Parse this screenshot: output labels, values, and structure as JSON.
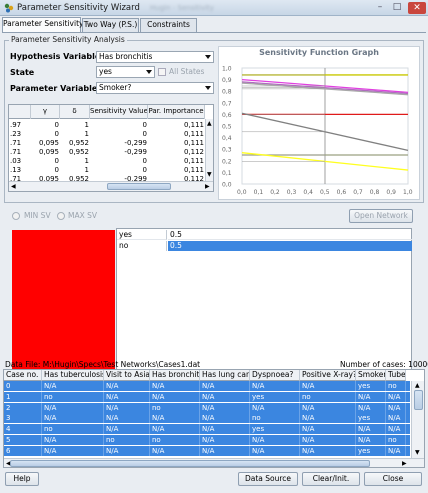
{
  "window": {
    "title": "Parameter Sensitivity Wizard",
    "blurred_text": "Hugin - Sensitivity"
  },
  "tabs": [
    "Parameter Sensitivity",
    "Two Way (P.S.)",
    "Constraints"
  ],
  "analysis": {
    "group_title": "Parameter Sensitivity Analysis",
    "hypothesis_label": "Hypothesis Variable",
    "hypothesis_value": "Has bronchitis",
    "state_label": "State",
    "state_value": "yes",
    "all_states_label": "All States",
    "parameter_label": "Parameter Variable",
    "parameter_value": "Smoker?"
  },
  "sens_table": {
    "headers": [
      "",
      "γ",
      "δ",
      "Sensitivity Value",
      "Par. Importance"
    ],
    "rows": [
      [
        ".97",
        "0",
        "1",
        "0",
        "0,111"
      ],
      [
        ".23",
        "0",
        "1",
        "0",
        "0,111"
      ],
      [
        ".71",
        "0,095",
        "0,952",
        "-0,299",
        "0,111"
      ],
      [
        ".71",
        "0,095",
        "0,952",
        "-0,299",
        "0,112"
      ],
      [
        ".03",
        "0",
        "1",
        "0",
        "0,111"
      ],
      [
        ".13",
        "0",
        "1",
        "0",
        "0,111"
      ],
      [
        ".71",
        "0,095",
        "0,952",
        "-0,299",
        "0,112"
      ]
    ]
  },
  "chart_data": {
    "type": "line",
    "title": "Sensitivity Function Graph",
    "xlim": [
      0,
      1
    ],
    "ylim": [
      0,
      1
    ],
    "x_ticks": [
      "0,0",
      "0,1",
      "0,2",
      "0,3",
      "0,4",
      "0,5",
      "0,6",
      "0,7",
      "0,8",
      "0,9",
      "1,0"
    ],
    "y_ticks": [
      "0,0",
      "0,1",
      "0,2",
      "0,3",
      "0,4",
      "0,5",
      "0,6",
      "0,7",
      "0,8",
      "0,9",
      "1,0"
    ],
    "marker_x": 0.5,
    "series": [
      {
        "color": "#c8c800",
        "x": [
          0,
          1
        ],
        "y": [
          0.94,
          0.94
        ]
      },
      {
        "color": "#e040e0",
        "x": [
          0,
          1
        ],
        "y": [
          0.9,
          0.79
        ]
      },
      {
        "color": "#b06ac0",
        "x": [
          0,
          1
        ],
        "y": [
          0.88,
          0.78
        ]
      },
      {
        "color": "#a8a8a8",
        "x": [
          0,
          1
        ],
        "y": [
          0.87,
          0.77
        ]
      },
      {
        "color": "#e01a1a",
        "x": [
          0,
          1
        ],
        "y": [
          0.6,
          0.6
        ]
      },
      {
        "color": "#808080",
        "x": [
          0,
          1
        ],
        "y": [
          0.61,
          0.29
        ]
      },
      {
        "color": "#9aa080",
        "x": [
          0,
          1
        ],
        "y": [
          0.25,
          0.25
        ]
      },
      {
        "color": "#ffff20",
        "x": [
          0,
          1
        ],
        "y": [
          0.27,
          0.12
        ]
      }
    ]
  },
  "controls": {
    "min_sv": "MIN SV",
    "max_sv": "MAX SV",
    "open_network": "Open Network"
  },
  "state_values": [
    {
      "state": "yes",
      "value": "0.5"
    },
    {
      "state": "no",
      "value": "0.5"
    }
  ],
  "data_file": {
    "label": "Data File: M:\\Hugin\\Specs\\Test Networks\\Cases1.dat",
    "count_label": "Number of cases: 10000"
  },
  "cases": {
    "headers": [
      "Case no.",
      "Has tuberculosis",
      "Visit to Asia?",
      "Has bronchitis",
      "Has lung cancer",
      "Dyspnoea?",
      "Positive X-ray?",
      "Smoker?",
      "Tube"
    ],
    "rows": [
      [
        "0",
        "N/A",
        "N/A",
        "N/A",
        "N/A",
        "N/A",
        "N/A",
        "yes",
        "no"
      ],
      [
        "1",
        "no",
        "N/A",
        "N/A",
        "N/A",
        "yes",
        "no",
        "N/A",
        "N/A"
      ],
      [
        "2",
        "N/A",
        "N/A",
        "no",
        "N/A",
        "N/A",
        "N/A",
        "N/A",
        "N/A"
      ],
      [
        "3",
        "N/A",
        "N/A",
        "N/A",
        "N/A",
        "no",
        "N/A",
        "yes",
        "N/A"
      ],
      [
        "4",
        "no",
        "N/A",
        "N/A",
        "N/A",
        "yes",
        "N/A",
        "N/A",
        "N/A"
      ],
      [
        "5",
        "N/A",
        "no",
        "no",
        "N/A",
        "N/A",
        "N/A",
        "N/A",
        "no"
      ],
      [
        "6",
        "N/A",
        "N/A",
        "N/A",
        "N/A",
        "N/A",
        "N/A",
        "yes",
        "N/A"
      ]
    ]
  },
  "footer": {
    "help": "Help",
    "data_source": "Data Source",
    "clear_init": "Clear/Init.",
    "close": "Close"
  }
}
